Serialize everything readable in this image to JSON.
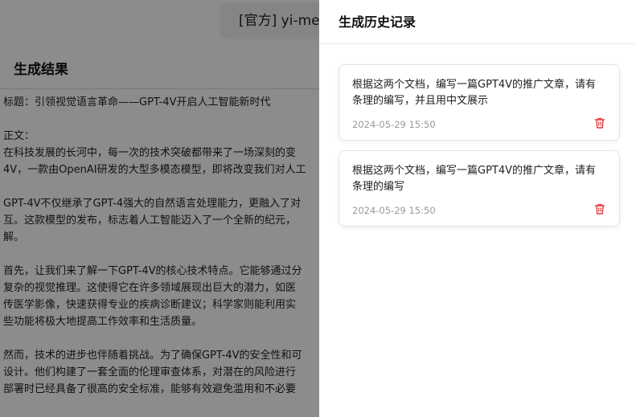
{
  "model_selector": {
    "label": "[官方]  yi-me"
  },
  "result": {
    "title": "生成结果",
    "paragraphs": [
      "标题：引领视觉语言革命——GPT-4V开启人工智能新时代",
      "正文：\n在科技发展的长河中，每一次的技术突破都带来了一场深刻的变\n4V，一款由OpenAI研发的大型多模态模型，即将改变我们对人工",
      "GPT-4V不仅继承了GPT-4强大的自然语言处理能力，更融入了对\n互。这款模型的发布，标志着人工智能迈入了一个全新的纪元，\n解。",
      "首先，让我们来了解一下GPT-4V的核心技术特点。它能够通过分\n复杂的视觉推理。这使得它在许多领域展现出巨大的潜力，如医\n传医学影像，快速获得专业的疾病诊断建议；科学家则能利用实\n些功能将极大地提高工作效率和生活质量。",
      "然而，技术的进步也伴随着挑战。为了确保GPT-4V的安全性和可\n设计。他们构建了一套全面的伦理审查体系，对潜在的风险进行\n部署时已经具备了很高的安全标准，能够有效避免滥用和不必要"
    ]
  },
  "history_drawer": {
    "title": "生成历史记录",
    "items": [
      {
        "text": "根据这两个文档，编写一篇GPT4V的推广文章，请有条理的编写，并且用中文展示",
        "time": "2024-05-29 15:50"
      },
      {
        "text": "根据这两个文档，编写一篇GPT4V的推广文章，请有条理的编写",
        "time": "2024-05-29 15:50"
      }
    ]
  },
  "colors": {
    "delete": "#e5383b",
    "mask": "rgba(0,0,0,0.45)"
  },
  "icons": {
    "delete": "trash-icon"
  }
}
